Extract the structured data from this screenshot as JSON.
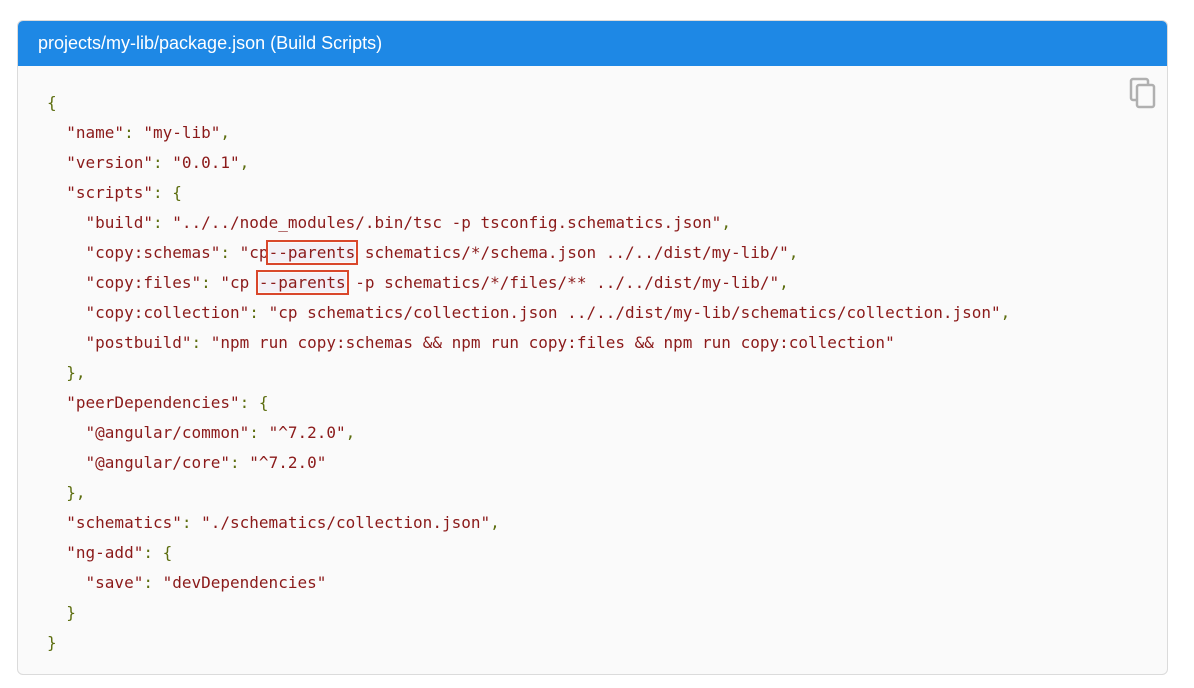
{
  "header": {
    "title": "projects/my-lib/package.json (Build Scripts)"
  },
  "copy_button": {
    "icon": "copy-icon"
  },
  "colors": {
    "header_bg": "#1e88e5",
    "string": "#8b1a1a",
    "punctuation": "#5c6d0e",
    "highlight_border": "#d9472b"
  },
  "code": {
    "l1": "{",
    "l2_indent": "  ",
    "l2_key": "\"name\"",
    "l2_sep": ": ",
    "l2_val": "\"my-lib\"",
    "l2_end": ",",
    "l3_key": "\"version\"",
    "l3_val": "\"0.0.1\"",
    "l4_key": "\"scripts\"",
    "l4_open": ": {",
    "l5_key": "\"build\"",
    "l5_val": "\"../../node_modules/.bin/tsc -p tsconfig.schematics.json\"",
    "l6_key": "\"copy:schemas\"",
    "l6_val_a": "\"cp",
    "l6_val_hl": "--parents",
    "l6_val_b": "schematics/*/schema.json ../../dist/my-lib/\"",
    "l7_key": "\"copy:files\"",
    "l7_val_a": "\"cp ",
    "l7_val_hl": "--parents",
    "l7_val_b": " -p schematics/*/files/** ../../dist/my-lib/\"",
    "l8_key": "\"copy:collection\"",
    "l8_val": "\"cp schematics/collection.json ../../dist/my-lib/schematics/collection.json\"",
    "l9_key": "\"postbuild\"",
    "l9_val": "\"npm run copy:schemas && npm run copy:files && npm run copy:collection\"",
    "l10": "},",
    "l11_key": "\"peerDependencies\"",
    "l12_key": "\"@angular/common\"",
    "l12_val": "\"^7.2.0\"",
    "l13_key": "\"@angular/core\"",
    "l13_val": "\"^7.2.0\"",
    "l14": "},",
    "l15_key": "\"schematics\"",
    "l15_val": "\"./schematics/collection.json\"",
    "l16_key": "\"ng-add\"",
    "l17_key": "\"save\"",
    "l17_val": "\"devDependencies\"",
    "l18": "}",
    "l19": "}"
  }
}
